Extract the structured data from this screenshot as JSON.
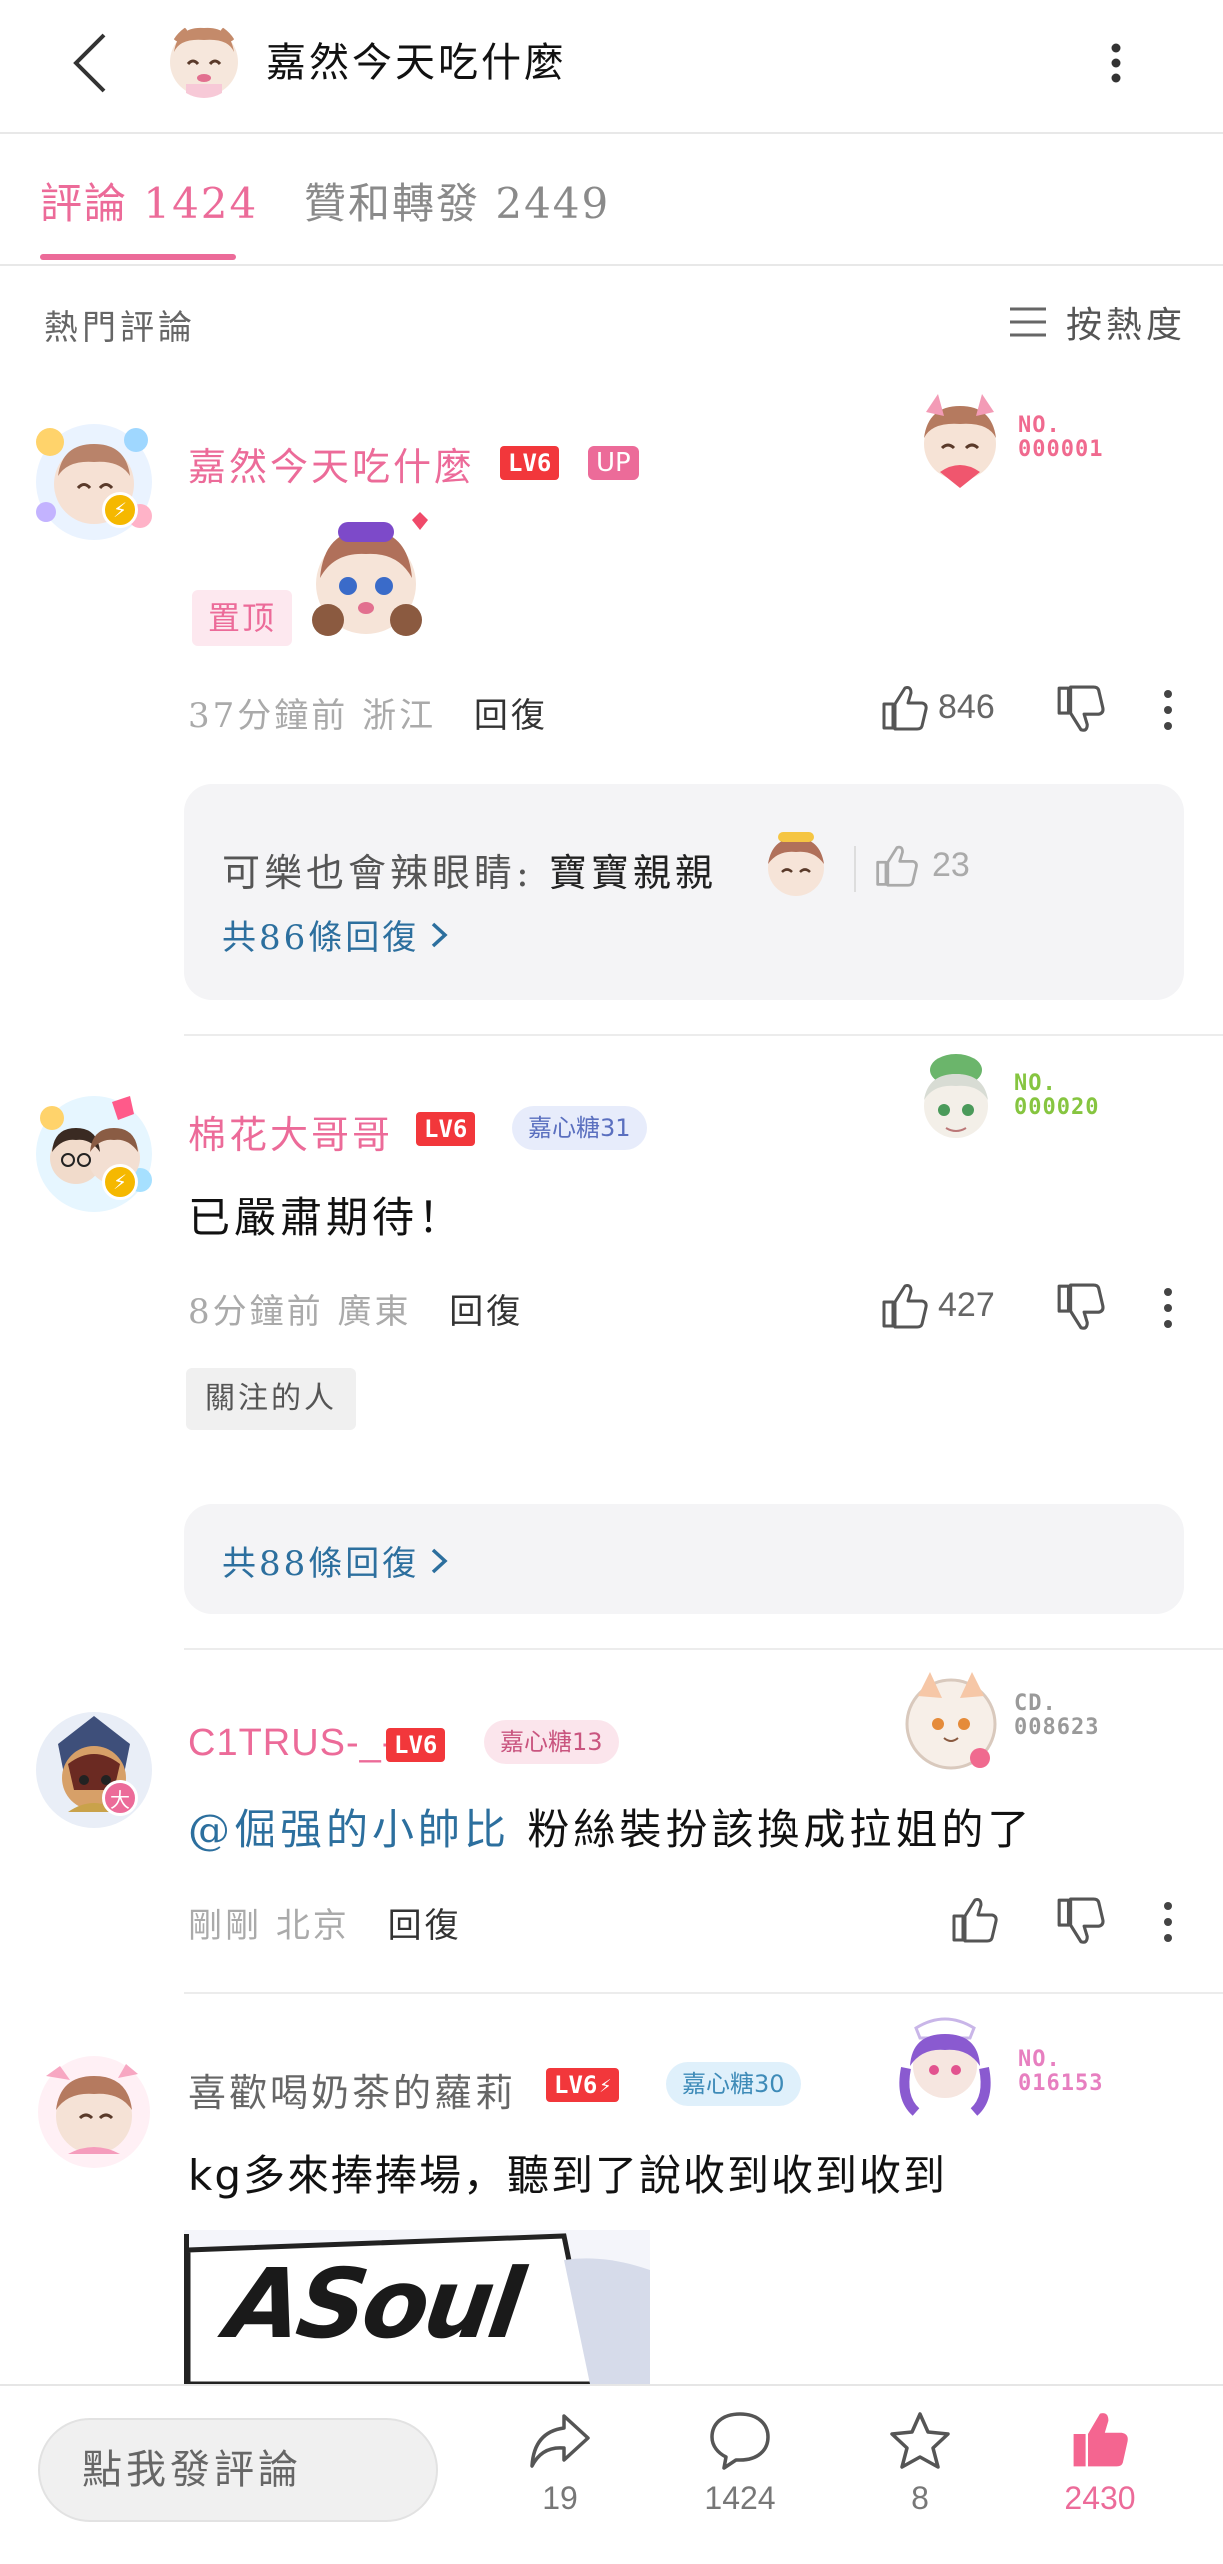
{
  "header": {
    "title": "嘉然今天吃什麼"
  },
  "tabs": [
    {
      "label": "評論 1424",
      "active": true
    },
    {
      "label": "贊和轉發 2449",
      "active": false
    }
  ],
  "section": {
    "title": "熱門評論",
    "sort_label": "按熱度"
  },
  "comments": [
    {
      "username": "嘉然今天吃什麼",
      "level": "LV6",
      "up_badge": "UP",
      "garb_label": "NO.",
      "garb_number": "000001",
      "pinned_label": "置顶",
      "time": "37分鐘前",
      "location": "浙江",
      "reply_label": "回復",
      "likes": "846",
      "sub_reply": {
        "author": "可樂也會辣眼睛:",
        "text": "寶寶親親",
        "likes": "23"
      },
      "more_replies": "共86條回復"
    },
    {
      "username": "棉花大哥哥",
      "level": "LV6",
      "fan_badge": "嘉心糖31",
      "garb_label": "NO.",
      "garb_number": "000020",
      "text": "已嚴肅期待！",
      "time": "8分鐘前",
      "location": "廣東",
      "reply_label": "回復",
      "likes": "427",
      "follow_tag": "關注的人",
      "more_replies": "共88條回復"
    },
    {
      "username": "C1TRUS-_-",
      "level": "LV6",
      "fan_badge": "嘉心糖13",
      "garb_label": "CD.",
      "garb_number": "008623",
      "mention": "@倔强的小帥比",
      "text": " 粉絲裝扮該換成拉姐的了",
      "time": "剛剛",
      "location": "北京",
      "reply_label": "回復",
      "vip_badge": "大"
    },
    {
      "username": "喜歡喝奶茶的蘿莉",
      "level": "LV6",
      "fan_badge": "嘉心糖30",
      "garb_label": "NO.",
      "garb_number": "016153",
      "text": "kg多來捧捧場，聽到了說收到收到收到",
      "image_logo_text": "ASoul"
    }
  ],
  "bottom": {
    "input_placeholder": "點我發評論",
    "share_count": "19",
    "comment_count": "1424",
    "favorite_count": "8",
    "like_count": "2430"
  },
  "colors": {
    "accent": "#ec6b99",
    "link": "#2c6f9e",
    "level": "#f2373b"
  }
}
